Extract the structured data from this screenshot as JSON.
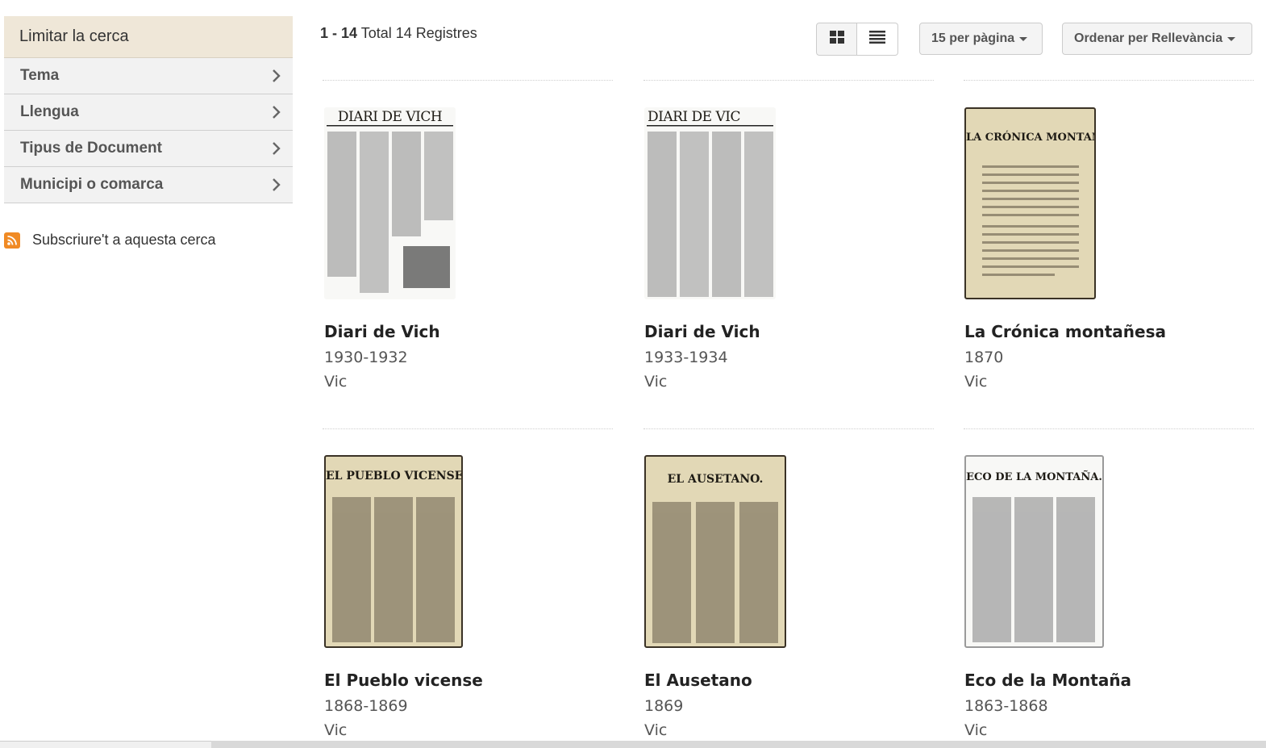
{
  "sidebar": {
    "header": "Limitar la cerca",
    "facets": [
      {
        "label": "Tema"
      },
      {
        "label": "Llengua"
      },
      {
        "label": "Tipus de Document"
      },
      {
        "label": "Municipi o comarca"
      }
    ],
    "subscribe_label": "Subscriure't a aquesta cerca"
  },
  "toolbar": {
    "range": "1 - 14",
    "total": "Total 14 Registres",
    "per_page": "15 per pàgina",
    "sort": "Ordenar per Rellevància"
  },
  "results": [
    {
      "title": "Diari de Vich",
      "years": "1930-1932",
      "place": "Vic",
      "masthead": "DIARI DE VICH"
    },
    {
      "title": "Diari de Vich",
      "years": "1933-1934",
      "place": "Vic",
      "masthead": "DIARI DE VIC"
    },
    {
      "title": "La Crónica montañesa",
      "years": "1870",
      "place": "Vic",
      "masthead": "LA CRÓNICA MONTAÑESA"
    },
    {
      "title": "El Pueblo vicense",
      "years": "1868-1869",
      "place": "Vic",
      "masthead": "EL PUEBLO VICENSE."
    },
    {
      "title": "El Ausetano",
      "years": "1869",
      "place": "Vic",
      "masthead": "EL AUSETANO."
    },
    {
      "title": "Eco de la Montaña",
      "years": "1863-1868",
      "place": "Vic",
      "masthead": "ECO DE LA MONTAÑA."
    }
  ]
}
